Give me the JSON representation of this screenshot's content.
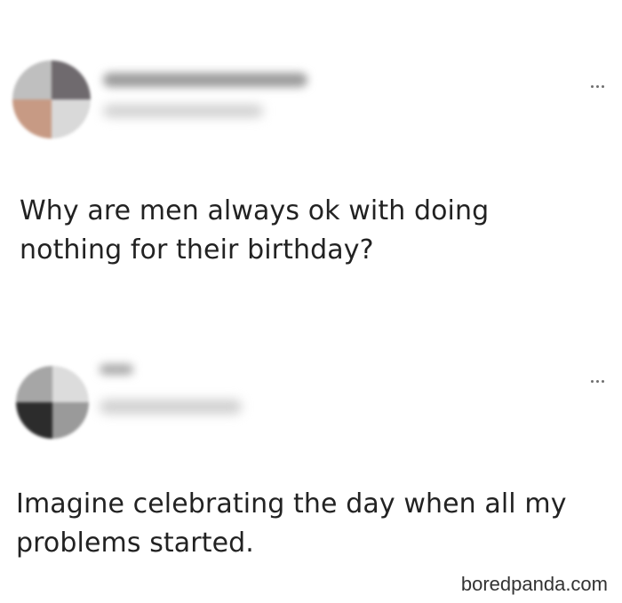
{
  "posts": [
    {
      "text": "Why are men always ok with doing nothing for their birthday?",
      "more_icon": "more-horizontal-icon"
    },
    {
      "text": "Imagine celebrating the day when all my problems started.",
      "more_icon": "more-horizontal-icon"
    }
  ],
  "watermark": "boredpanda.com",
  "colors": {
    "background": "#ffffff",
    "text": "#222222"
  }
}
